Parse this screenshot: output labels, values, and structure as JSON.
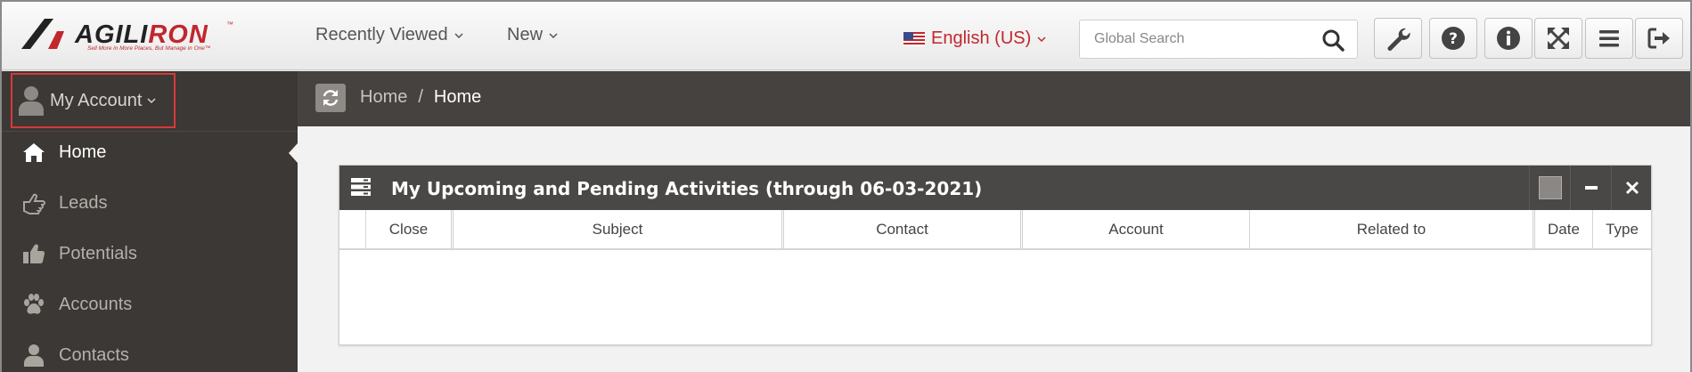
{
  "header": {
    "logo_text": "AGILIRON",
    "logo_tagline": "Sell More in More Places, But Manage in One™",
    "logo_tm": "™",
    "nav": [
      {
        "label": "Recently Viewed"
      },
      {
        "label": "New"
      }
    ],
    "language": "English (US)",
    "search_placeholder": "Global Search",
    "toolbar_icons": [
      "wrench-icon",
      "help-icon",
      "info-icon",
      "expand-icon",
      "menu-icon",
      "logout-icon"
    ]
  },
  "sidebar": {
    "account_label": "My Account",
    "items": [
      {
        "label": "Home",
        "icon": "home-icon",
        "active": true
      },
      {
        "label": "Leads",
        "icon": "hand-pointer-icon"
      },
      {
        "label": "Potentials",
        "icon": "thumbs-up-icon"
      },
      {
        "label": "Accounts",
        "icon": "paw-icon"
      },
      {
        "label": "Contacts",
        "icon": "user-icon"
      }
    ]
  },
  "breadcrumb": {
    "items": [
      "Home",
      "Home"
    ],
    "separator": "/"
  },
  "widget": {
    "title": "My Upcoming and Pending Activities (through 06-03-2021)",
    "columns": [
      "",
      "Close",
      "Subject",
      "Contact",
      "Account",
      "Related to",
      "Date",
      "Type"
    ],
    "rows": []
  },
  "colors": {
    "brand_red": "#c1272d",
    "sidebar_bg": "#3b3835",
    "crumbbar_bg": "#45423f",
    "widget_header_bg": "#4a4846",
    "highlight_border": "#d9383a"
  }
}
